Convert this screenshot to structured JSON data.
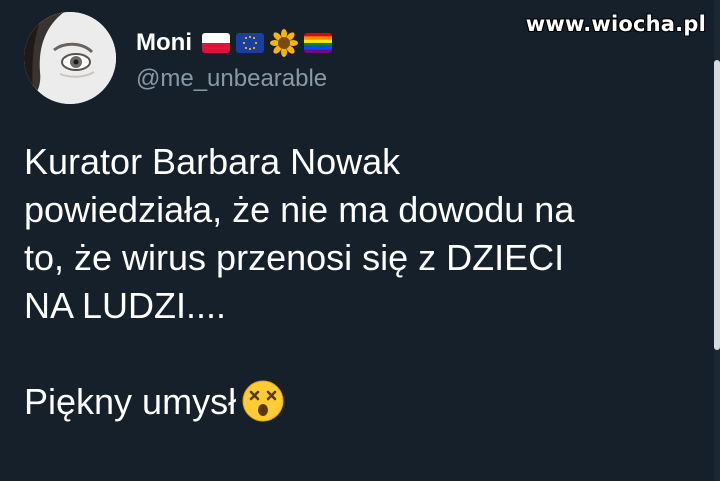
{
  "user": {
    "display_name": "Moni",
    "handle": "@me_unbearable",
    "flags": [
      "poland-flag-icon",
      "eu-flag-icon",
      "sunflower-icon",
      "rainbow-flag-icon"
    ]
  },
  "watermark": "www.wiocha.pl",
  "tweet": {
    "lines": [
      "Kurator Barbara Nowak",
      "powiedziała, że nie ma dowodu na",
      "to, że wirus przenosi się z DZIECI",
      "NA LUDZI...."
    ],
    "closing": "Piękny umysł",
    "closing_emoji": "dizzy-face-emoji-icon"
  },
  "colors": {
    "background": "#15202b",
    "text": "#ffffff",
    "handle": "#8899a6"
  }
}
